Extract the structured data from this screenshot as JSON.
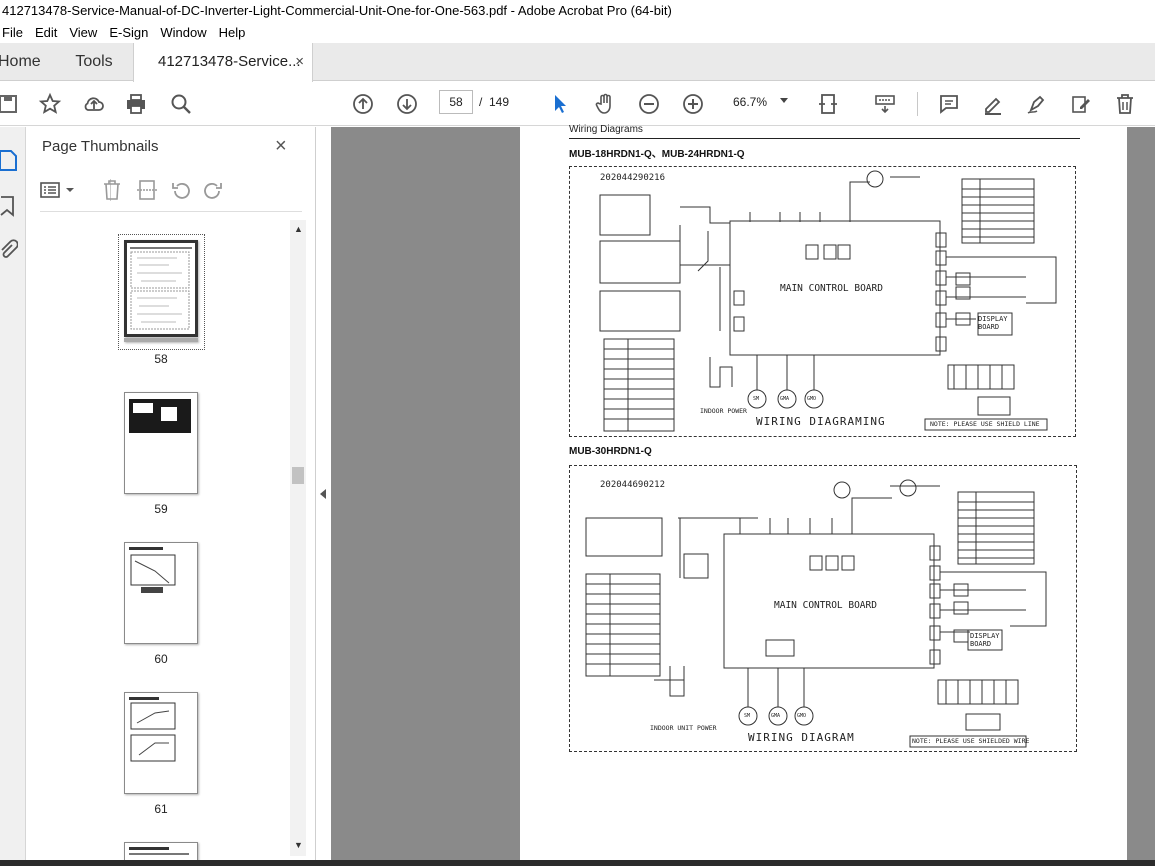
{
  "window": {
    "title": "412713478-Service-Manual-of-DC-Inverter-Light-Commercial-Unit-One-for-One-563.pdf - Adobe Acrobat Pro (64-bit)"
  },
  "menu": [
    "File",
    "Edit",
    "View",
    "E-Sign",
    "Window",
    "Help"
  ],
  "tabs": {
    "home": "Home",
    "tools": "Tools",
    "document": "412713478-Service...",
    "close": "×"
  },
  "toolbar": {
    "page_current": "58",
    "page_sep": "/",
    "page_total": "149",
    "zoom": "66.7%"
  },
  "thumbnails_panel": {
    "title": "Page Thumbnails",
    "close": "×",
    "pages": [
      "58",
      "59",
      "60",
      "61"
    ]
  },
  "document": {
    "section_header": "Wiring Diagrams",
    "diagram1": {
      "heading": "MUB-18HRDN1-Q、MUB-24HRDN1-Q",
      "code": "202044290216",
      "board": "MAIN CONTROL BOARD",
      "display": "DISPLAY BOARD",
      "title": "WIRING DIAGRAMING",
      "power": "INDOOR POWER",
      "note": "NOTE: PLEASE USE SHIELD LINE",
      "motors": [
        "SM",
        "GMA",
        "GMO"
      ]
    },
    "diagram2": {
      "heading": "MUB-30HRDN1-Q",
      "code": "202044690212",
      "board": "MAIN CONTROL BOARD",
      "display": "DISPLAY BOARD",
      "title": "WIRING DIAGRAM",
      "power": "INDOOR UNIT POWER",
      "note": "NOTE: PLEASE USE SHIELDED WIRE",
      "motors": [
        "SM",
        "GMA",
        "GMO"
      ]
    }
  }
}
